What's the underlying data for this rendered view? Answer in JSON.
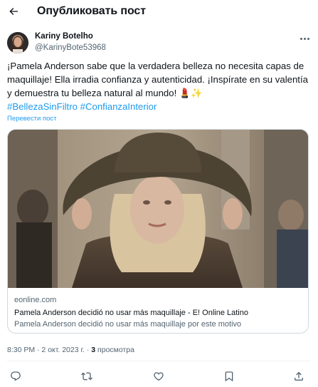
{
  "header": {
    "title": "Опубликовать пост",
    "back_icon": "arrow-left-icon"
  },
  "author": {
    "name": "Kariny Botelho",
    "handle": "@KarinyBote53968",
    "avatar_icon": "avatar"
  },
  "tweet": {
    "text": "¡Pamela Anderson sabe que la verdadera belleza no necesita capas de maquillaje! Ella irradia confianza y autenticidad. ¡Inspírate en su valentía y demuestra tu belleza natural al mundo! 💄✨",
    "hashtags": [
      "#BellezaSinFiltro",
      "#ConfianzaInterior"
    ],
    "translate_label": "Перевести пост"
  },
  "card": {
    "domain": "eonline.com",
    "title": "Pamela Anderson decidió no usar más maquillaje - E! Online Latino",
    "description": "Pamela Anderson decidió no usar más maquillaje por este motivo"
  },
  "meta": {
    "timestamp": "8:30 PM · 2 окт. 2023 г. · ",
    "views_count": "3",
    "views_label": " просмотра"
  },
  "actions": {
    "icons": [
      "reply-icon",
      "retweet-icon",
      "like-icon",
      "bookmark-icon",
      "share-icon"
    ]
  },
  "colors": {
    "accent": "#1d9bf0",
    "text_primary": "#0f1419",
    "text_secondary": "#536471",
    "border": "#cfd9de"
  }
}
